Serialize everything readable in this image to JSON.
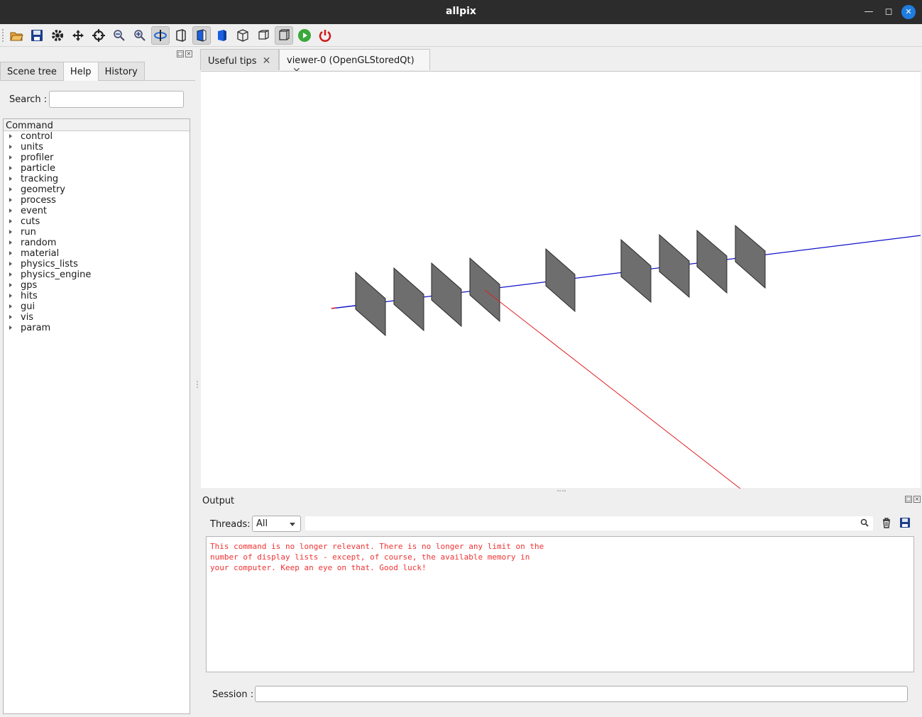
{
  "window": {
    "title": "allpix"
  },
  "toolbar": {
    "buttons": [
      {
        "name": "open-icon"
      },
      {
        "name": "save-icon"
      },
      {
        "name": "settings-icon"
      },
      {
        "name": "move-icon"
      },
      {
        "name": "pick-icon"
      },
      {
        "name": "zoom-out-icon"
      },
      {
        "name": "zoom-in-icon"
      },
      {
        "name": "rotate-icon"
      },
      {
        "name": "hidden-line-icon"
      },
      {
        "name": "solid-icon"
      },
      {
        "name": "solid-blue-icon"
      },
      {
        "name": "wireframe-icon"
      },
      {
        "name": "perspective-icon"
      },
      {
        "name": "ortho-icon"
      },
      {
        "name": "run-icon"
      },
      {
        "name": "exit-icon"
      }
    ]
  },
  "left_dock": {
    "tabs": [
      "Scene tree",
      "Help",
      "History"
    ],
    "active_tab": "Help",
    "search_label": "Search :",
    "search_value": "",
    "tree_header": "Command",
    "commands": [
      "control",
      "units",
      "profiler",
      "particle",
      "tracking",
      "geometry",
      "process",
      "event",
      "cuts",
      "run",
      "random",
      "material",
      "physics_lists",
      "physics_engine",
      "gps",
      "hits",
      "gui",
      "vis",
      "param"
    ]
  },
  "center_tabs": [
    {
      "label": "Useful tips",
      "active": false
    },
    {
      "label": "viewer-0 (OpenGLStoredQt)",
      "active": true
    }
  ],
  "output_dock": {
    "title": "Output",
    "threads_label": "Threads:",
    "threads_value": "All",
    "filter_value": "",
    "lines": [
      "This command is no longer relevant. There is no longer any limit on the",
      "number of display lists - except, of course, the available memory in",
      "your computer. Keep an eye on that. Good luck!"
    ],
    "session_label": "Session :",
    "session_value": ""
  },
  "colors": {
    "beam": "#1010c8",
    "track": "#e02020",
    "plane": "#6e6e6e",
    "error_text": "#ee3333"
  }
}
